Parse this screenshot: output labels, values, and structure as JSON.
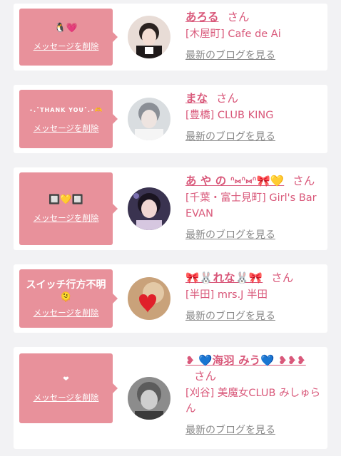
{
  "items": [
    {
      "message": "🐧💗",
      "delete_label": "メッセージを削除",
      "name": "あろる",
      "san": "さん",
      "shop": "[木屋町] Cafe de Ai",
      "blog_label": "最新のブログを見る",
      "avatar": "avatar-photo"
    },
    {
      "message": "⋆.˚THANK YOU˚.⋆🫶",
      "delete_label": "メッセージを削除",
      "name": "まな",
      "san": "さん",
      "shop": "[豊橋] CLUB KING",
      "blog_label": "最新のブログを見る",
      "avatar": "avatar-photo"
    },
    {
      "message": "🔲💛🔲",
      "delete_label": "メッセージを削除",
      "name": "あ や の ᐢ⑅ᐢ⑅ᐢ🎀💛",
      "san": "さん",
      "shop": "[千葉・富士見町] Girl's Bar EVAN",
      "blog_label": "最新のブログを見る",
      "avatar": "avatar-photo"
    },
    {
      "message": "スイッチ行方不明",
      "message2": "🫠",
      "delete_label": "メッセージを削除",
      "name": "🎀🐰れな🐰🎀",
      "san": "さん",
      "shop": "[半田] mrs.J 半田",
      "blog_label": "最新のブログを見る",
      "avatar": "avatar-photo"
    },
    {
      "message": "❤",
      "delete_label": "メッセージを削除",
      "name": "❥ 💙海羽 みう💙 ❥❥❥",
      "san": "さん",
      "shop": "[刈谷] 美魔女CLUB みしゅらん",
      "blog_label": "最新のブログを見る",
      "avatar": "avatar-photo"
    }
  ],
  "colors": {
    "accent": "#d9587a",
    "bubble": "#e8919b",
    "muted": "#8a8a8a",
    "background": "#f2f2f4"
  }
}
